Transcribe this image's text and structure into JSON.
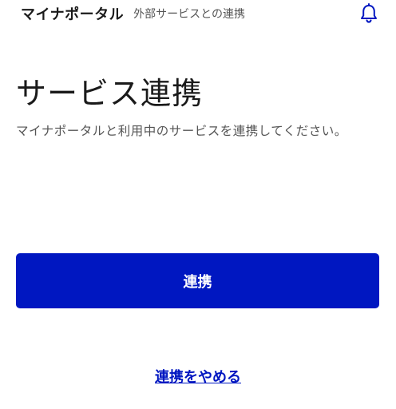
{
  "header": {
    "app_title": "マイナポータル",
    "subtitle": "外部サービスとの連携",
    "notification_icon": "bell-icon"
  },
  "main": {
    "title": "サービス連携",
    "description": "マイナポータルと利用中のサービスを連携してください。",
    "connect_button_label": "連携",
    "cancel_link_label": "連携をやめる"
  },
  "colors": {
    "accent": "#0017c1",
    "text": "#1a1a1a",
    "muted_text": "#555555",
    "background": "#ffffff"
  }
}
